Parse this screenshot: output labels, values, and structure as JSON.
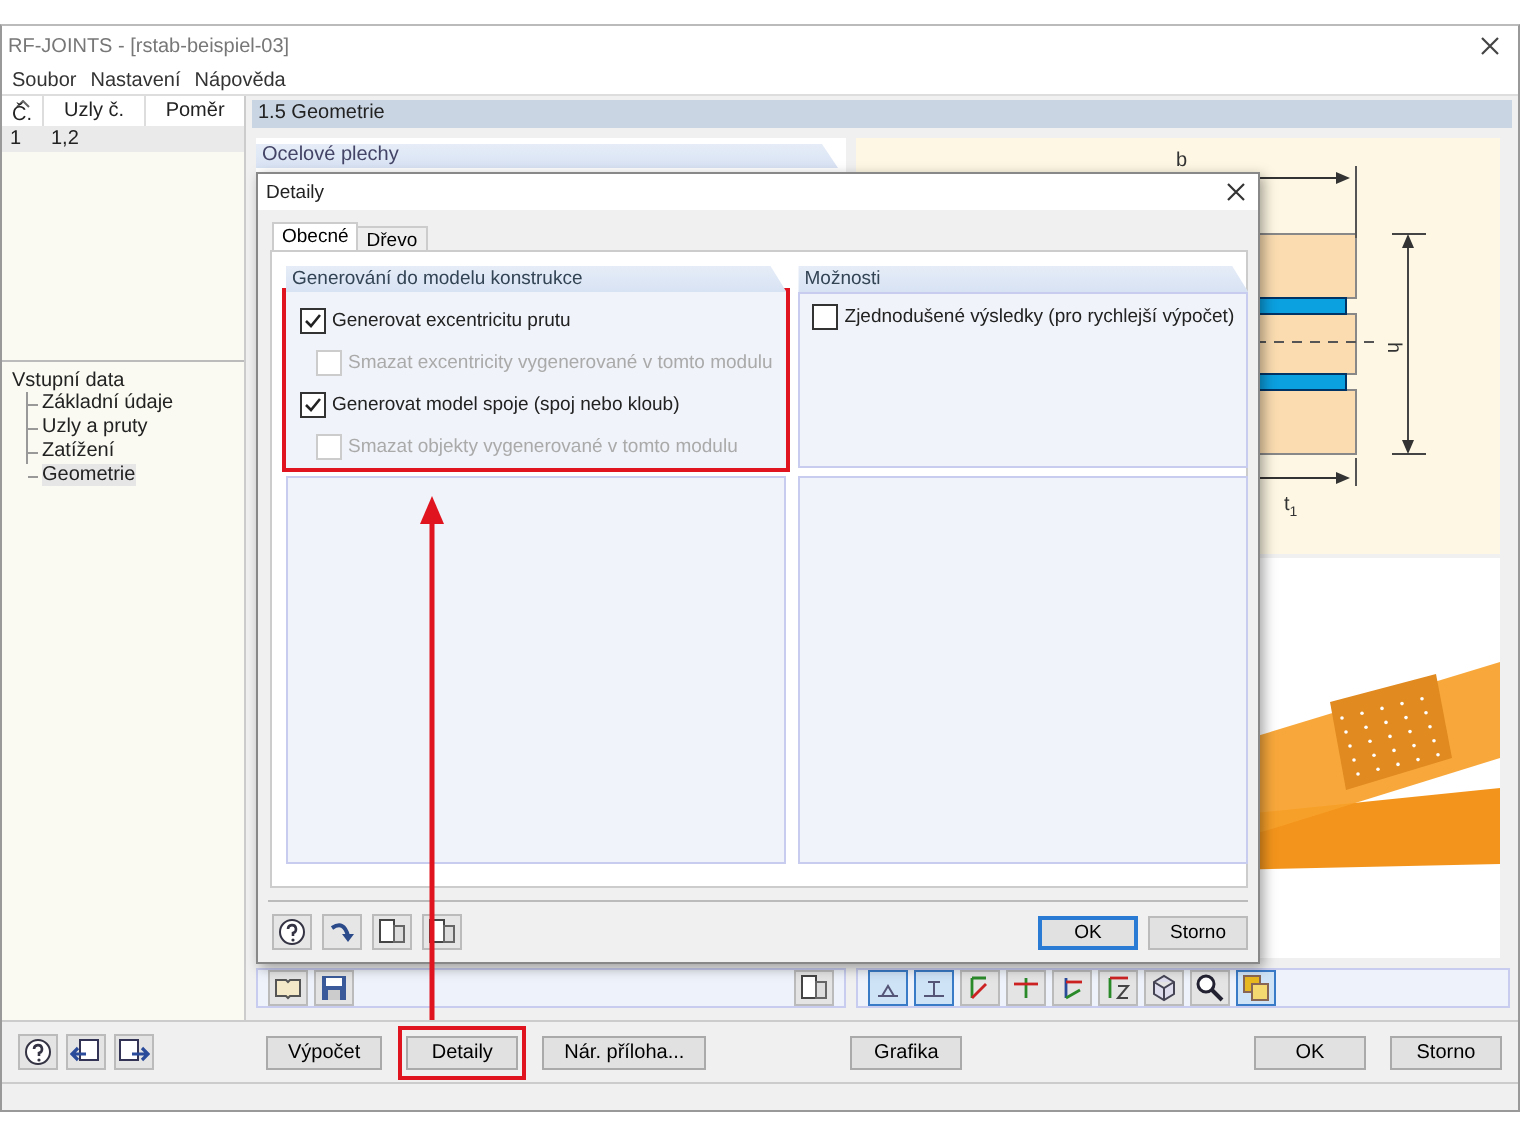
{
  "window": {
    "title": "RF-JOINTS - [rstab-beispiel-03]"
  },
  "menu": [
    {
      "label": "Soubor"
    },
    {
      "label": "Nastavení"
    },
    {
      "label": "Nápověda"
    }
  ],
  "left_table": {
    "columns": [
      "Č.",
      "Uzly č.",
      "Poměr"
    ],
    "rows": [
      {
        "cells": [
          "1",
          "1,2"
        ],
        "selected": true
      }
    ]
  },
  "tree": {
    "label": "Vstupní data",
    "children": [
      {
        "label": "Základní údaje",
        "selected": false
      },
      {
        "label": "Uzly a pruty",
        "selected": false
      },
      {
        "label": "Zatížení",
        "selected": false
      },
      {
        "label": "Geometrie",
        "selected": true
      }
    ]
  },
  "panel": {
    "title": "1.5 Geometrie",
    "section": "Ocelové plechy"
  },
  "diagram": {
    "labels": [
      "b",
      "h",
      "t$_{1}$"
    ]
  },
  "view_toolbar": [
    {
      "kind": "beam-front",
      "pressed": true
    },
    {
      "kind": "beam-side",
      "pressed": true
    },
    {
      "kind": "axis-x",
      "pressed": false
    },
    {
      "kind": "axis-neg-x",
      "pressed": false
    },
    {
      "kind": "axis-y",
      "pressed": false
    },
    {
      "kind": "axis-z",
      "pressed": false
    },
    {
      "kind": "cube",
      "pressed": false
    },
    {
      "kind": "zoom",
      "pressed": false
    },
    {
      "kind": "layers",
      "pressed": true
    }
  ],
  "dialog": {
    "title": "Detaily",
    "tabs": [
      {
        "label": "Obecné",
        "selected": true
      },
      {
        "label": "Dřevo",
        "selected": false
      }
    ],
    "groups": [
      {
        "title": "Generování do modelu konstrukce",
        "highlighted": true,
        "options": [
          {
            "label": "Generovat excentricitu prutu",
            "checked": true,
            "disabled": false,
            "children": [
              {
                "label": "Smazat excentricity vygenerované v tomto modulu",
                "checked": false,
                "disabled": true
              }
            ]
          },
          {
            "label": "Generovat model spoje (spoj nebo kloub)",
            "checked": true,
            "disabled": false,
            "children": [
              {
                "label": "Smazat objekty vygenerované v tomto modulu",
                "checked": false,
                "disabled": true
              }
            ]
          }
        ]
      },
      {
        "title": "Možnosti",
        "highlighted": false,
        "options": [
          {
            "label": "Zjednodušené výsledky (pro rychlejší výpočet)",
            "checked": false,
            "disabled": false
          }
        ]
      }
    ],
    "buttons": [
      {
        "label": "OK",
        "default": true
      },
      {
        "label": "Storno",
        "default": false
      }
    ]
  },
  "bottom_buttons": {
    "left": [
      {
        "label": "Výpočet",
        "highlighted": false
      },
      {
        "label": "Detaily",
        "highlighted": true
      },
      {
        "label": "Nár. příloha...",
        "highlighted": false
      }
    ],
    "center": [
      {
        "label": "Grafika",
        "highlighted": false
      }
    ],
    "right": [
      {
        "label": "OK",
        "highlighted": false
      },
      {
        "label": "Storno",
        "highlighted": false
      }
    ]
  }
}
